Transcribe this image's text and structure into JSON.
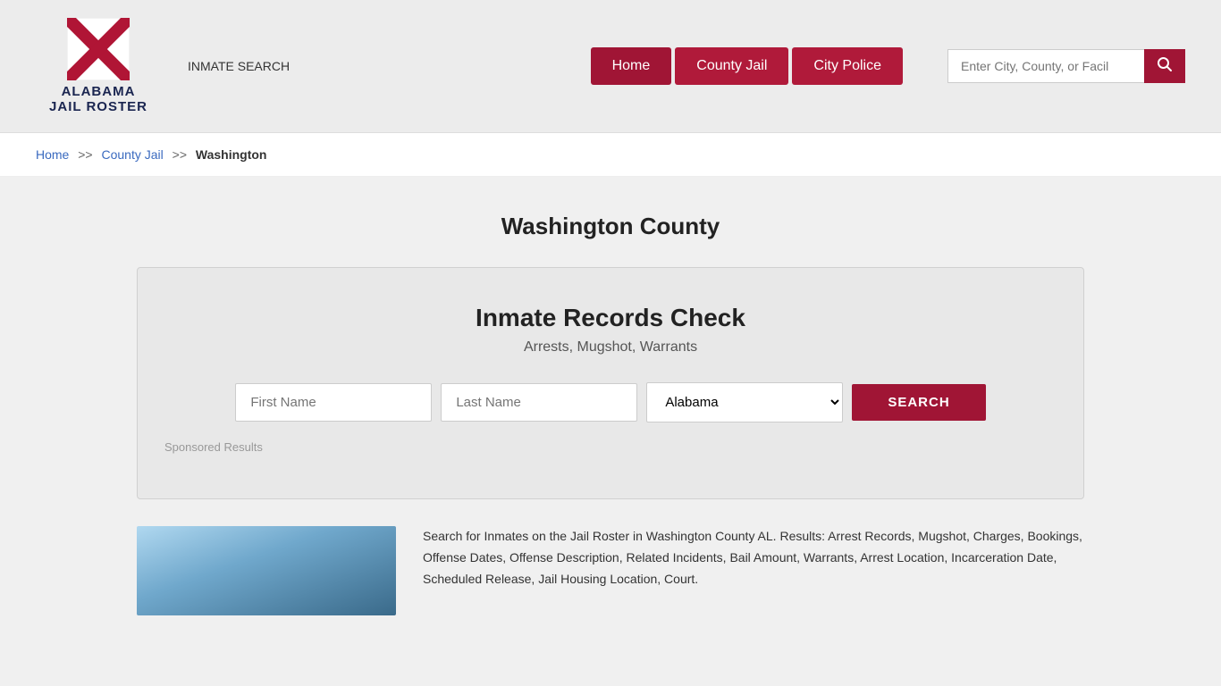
{
  "header": {
    "logo_line1": "ALABAMA",
    "logo_line2": "JAIL ROSTER",
    "inmate_search_label": "INMATE SEARCH",
    "nav": {
      "home": "Home",
      "county_jail": "County Jail",
      "city_police": "City Police"
    },
    "search_placeholder": "Enter City, County, or Facil"
  },
  "breadcrumb": {
    "home": "Home",
    "sep1": ">>",
    "county_jail": "County Jail",
    "sep2": ">>",
    "current": "Washington"
  },
  "page": {
    "title": "Washington County"
  },
  "records_box": {
    "title": "Inmate Records Check",
    "subtitle": "Arrests, Mugshot, Warrants",
    "first_name_placeholder": "First Name",
    "last_name_placeholder": "Last Name",
    "state_default": "Alabama",
    "search_button": "SEARCH",
    "sponsored_label": "Sponsored Results"
  },
  "bottom": {
    "description": "Search for Inmates on the Jail Roster in Washington County AL. Results: Arrest Records, Mugshot, Charges, Bookings, Offense Dates, Offense Description, Related Incidents, Bail Amount, Warrants, Arrest Location, Incarceration Date, Scheduled Release, Jail Housing Location, Court."
  },
  "colors": {
    "brand_red": "#a01535",
    "nav_red": "#b01a3a",
    "link_blue": "#3a6abf",
    "logo_dark": "#1a2550"
  }
}
